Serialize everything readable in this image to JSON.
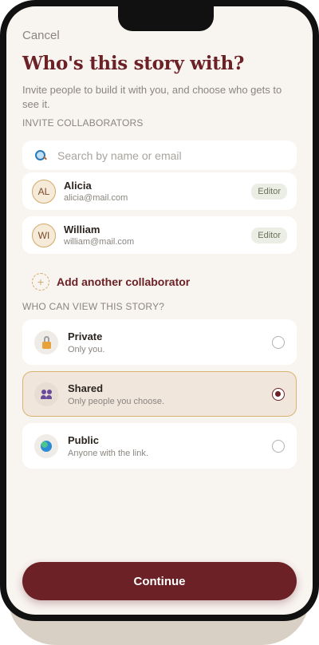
{
  "nav": {
    "cancel_label": "Cancel"
  },
  "header": {
    "title": "Who's this story with?",
    "subtitle": "Invite people to build it with you, and choose who gets to see it."
  },
  "invite": {
    "section_label": "INVITE COLLABORATORS",
    "search_placeholder": "Search by name or email",
    "collaborators": [
      {
        "initials": "AL",
        "name": "Alicia",
        "email": "alicia@mail.com",
        "role": "Editor"
      },
      {
        "initials": "WI",
        "name": "William",
        "email": "william@mail.com",
        "role": "Editor"
      }
    ],
    "add_label": "Add another collaborator",
    "add_icon": "+"
  },
  "visibility": {
    "section_label": "WHO CAN VIEW THIS STORY?",
    "selected": "shared",
    "options": [
      {
        "id": "private",
        "icon": "lock-icon",
        "title": "Private",
        "desc": "Only you."
      },
      {
        "id": "shared",
        "icon": "people-icon",
        "title": "Shared",
        "desc": "Only people you choose."
      },
      {
        "id": "public",
        "icon": "globe-icon",
        "title": "Public",
        "desc": "Anyone with the link."
      }
    ]
  },
  "footer": {
    "continue_label": "Continue"
  },
  "colors": {
    "accent": "#6b2125",
    "background": "#f8f4f0",
    "selected_border": "#d8b270"
  }
}
